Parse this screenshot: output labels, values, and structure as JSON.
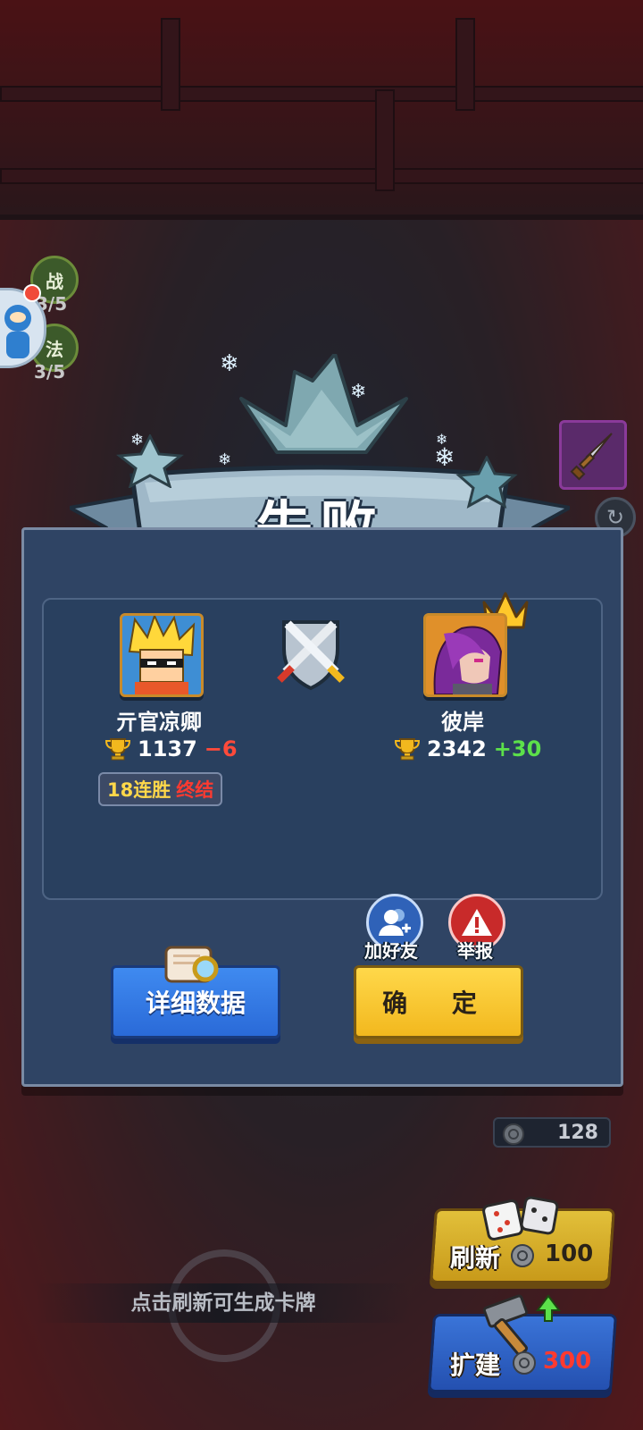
{
  "side": {
    "badge1_label": "战",
    "badge1_count": "3/5",
    "badge2_label": "法",
    "badge2_count": "3/5"
  },
  "result": {
    "title": "失败"
  },
  "player_left": {
    "name": "亓官凉卿",
    "trophies": "1137",
    "delta": "−6",
    "streak_text": "18连胜",
    "streak_end": "终结"
  },
  "player_right": {
    "name": "彼岸",
    "trophies": "2342",
    "delta": "+30"
  },
  "actions": {
    "add_friend": "加好友",
    "report": "举报",
    "details": "详细数据",
    "confirm": "确 定"
  },
  "hud": {
    "coins": "128",
    "hint": "点击刷新可生成卡牌",
    "refresh_label": "刷新",
    "refresh_cost": "100",
    "build_label": "扩建",
    "build_cost": "300"
  },
  "colors": {
    "loss_delta": "#ff4a3a",
    "gain_delta": "#5ce04a",
    "streak": "#ffd84a",
    "streak_end": "#ff3a30",
    "confirm_button": "#f2b81e",
    "details_button": "#2a6ad8"
  },
  "icons": {
    "trophy": "trophy-icon",
    "swords": "crossed-swords-icon",
    "crown": "crown-icon",
    "add_friend": "add-friend-icon",
    "report": "warning-icon",
    "coin": "coin-icon",
    "dice": "dice-icon",
    "hammer": "hammer-icon",
    "weapon": "sword-icon",
    "history": "history-icon",
    "snowflake": "snowflake-icon"
  }
}
